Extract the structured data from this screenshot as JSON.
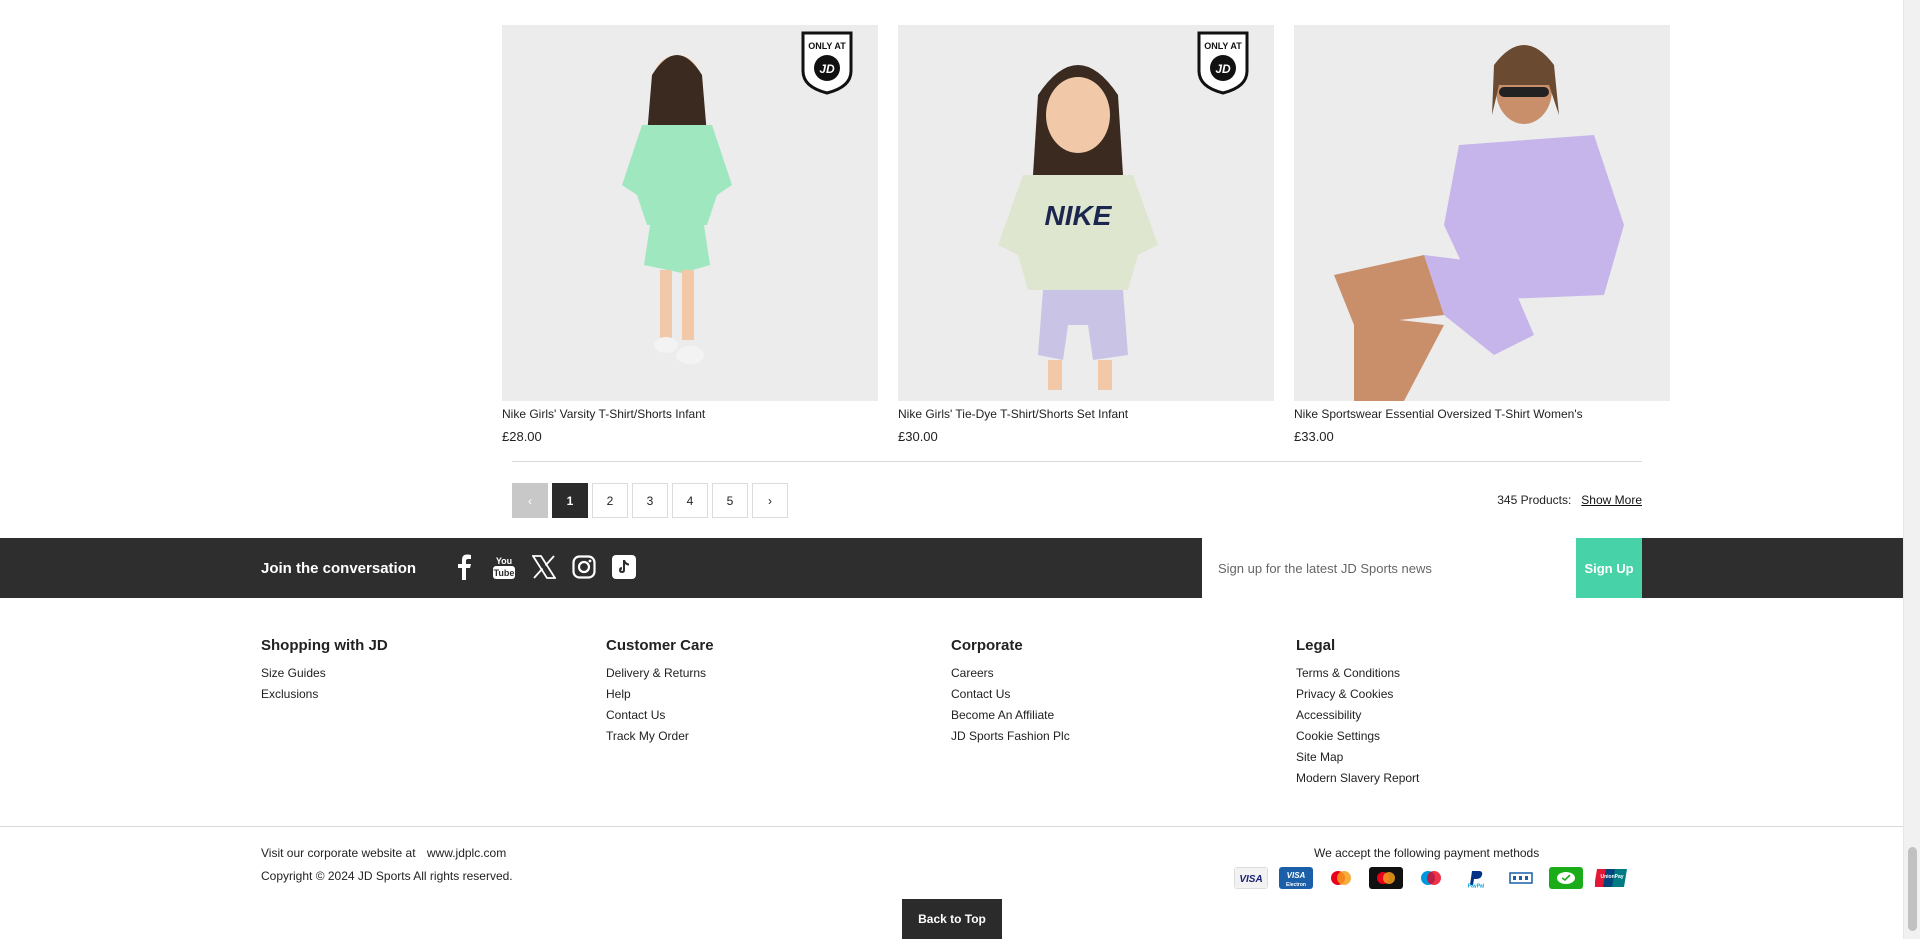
{
  "products": [
    {
      "name": "Nike Girls' Varsity T-Shirt/Shorts Infant",
      "price": "£28.00",
      "badge": "ONLY AT JD",
      "color": "#9fe8bf"
    },
    {
      "name": "Nike Girls' Tie-Dye T-Shirt/Shorts Set Infant",
      "price": "£30.00",
      "badge": "ONLY AT JD",
      "color": "#c9c4e6"
    },
    {
      "name": "Nike Sportswear Essential Oversized T-Shirt Women's",
      "price": "£33.00",
      "badge": "",
      "color": "#c6b5ea"
    }
  ],
  "pagination": {
    "prev": "‹",
    "pages": [
      "1",
      "2",
      "3",
      "4",
      "5"
    ],
    "active": "1",
    "next": "›",
    "count_label": "345 Products:",
    "show_more": "Show More"
  },
  "social": {
    "label": "Join the conversation",
    "icons": [
      "facebook-icon",
      "youtube-icon",
      "x-icon",
      "instagram-icon",
      "tiktok-icon"
    ],
    "youtube_text": "You Tube"
  },
  "signup": {
    "placeholder": "Sign up for the latest JD Sports news",
    "button": "Sign Up"
  },
  "footer": {
    "columns": [
      {
        "title": "Shopping with JD",
        "links": [
          "Size Guides",
          "Exclusions"
        ]
      },
      {
        "title": "Customer Care",
        "links": [
          "Delivery & Returns",
          "Help",
          "Contact Us",
          "Track My Order"
        ]
      },
      {
        "title": "Corporate",
        "links": [
          "Careers",
          "Contact Us",
          "Become An Affiliate",
          "JD Sports Fashion Plc"
        ]
      },
      {
        "title": "Legal",
        "links": [
          "Terms & Conditions",
          "Privacy & Cookies",
          "Accessibility",
          "Cookie Settings",
          "Site Map",
          "Modern Slavery Report"
        ]
      }
    ],
    "corporate_text": "Visit our corporate website at",
    "corporate_link": "www.jdplc.com",
    "copyright": "Copyright © 2024 JD Sports All rights reserved.",
    "payment_label": "We accept the following payment methods",
    "payment_methods": [
      {
        "name": "visa-icon",
        "text": "VISA",
        "color": "#ffffff",
        "fg": "#1a1f71"
      },
      {
        "name": "visa-electron-icon",
        "text": "VISA",
        "color": "#1a5fa8",
        "fg": "#ffffff"
      },
      {
        "name": "mastercard-icon",
        "text": "",
        "color": "#ffffff",
        "fg": "#000"
      },
      {
        "name": "mastercard-black-icon",
        "text": "",
        "color": "#111111",
        "fg": "#fff"
      },
      {
        "name": "maestro-icon",
        "text": "",
        "color": "#ffffff",
        "fg": "#000"
      },
      {
        "name": "paypal-icon",
        "text": "PayPal",
        "color": "#ffffff",
        "fg": "#003087"
      },
      {
        "name": "bank-icon",
        "text": "",
        "color": "#ffffff",
        "fg": "#1a5fa8"
      },
      {
        "name": "wechat-pay-icon",
        "text": "",
        "color": "#1aad19",
        "fg": "#fff"
      },
      {
        "name": "unionpay-icon",
        "text": "UnionPay",
        "color": "#0f6fb8",
        "fg": "#fff"
      }
    ],
    "back_to_top": "Back to Top"
  }
}
